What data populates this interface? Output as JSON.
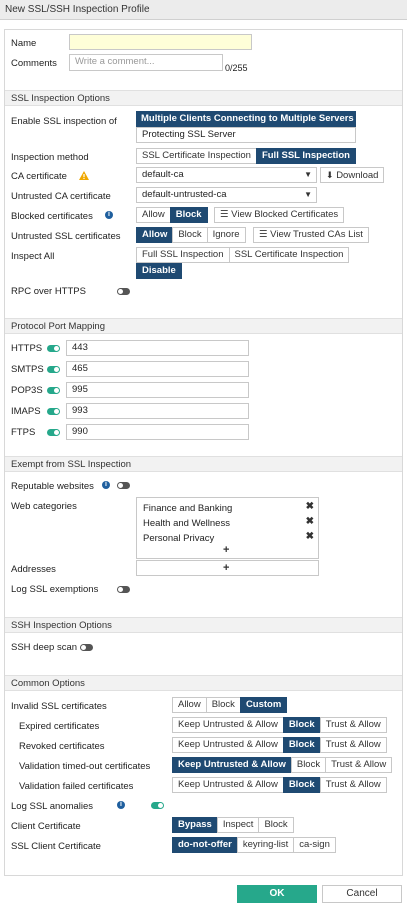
{
  "window": {
    "title": "New SSL/SSH Inspection Profile"
  },
  "general": {
    "name_label": "Name",
    "name_value": "",
    "comments_label": "Comments",
    "comments_placeholder": "Write a comment...",
    "comments_count": "0/255"
  },
  "ssl_options": {
    "header": "SSL Inspection Options",
    "enable_label": "Enable SSL inspection of",
    "enable_options": [
      "Multiple Clients Connecting to Multiple Servers",
      "Protecting SSL Server"
    ],
    "method_label": "Inspection method",
    "method_options": [
      "SSL Certificate Inspection",
      "Full SSL Inspection"
    ],
    "ca_label": "CA certificate",
    "ca_value": "default-ca",
    "download_label": "Download",
    "untrusted_ca_label": "Untrusted CA certificate",
    "untrusted_ca_value": "default-untrusted-ca",
    "blocked_label": "Blocked certificates",
    "blocked_options": [
      "Allow",
      "Block"
    ],
    "view_blocked_label": "View Blocked Certificates",
    "untrusted_ssl_label": "Untrusted SSL certificates",
    "untrusted_ssl_options": [
      "Allow",
      "Block",
      "Ignore"
    ],
    "view_trusted_label": "View Trusted CAs List",
    "inspect_all_label": "Inspect All",
    "inspect_all_options": [
      "Full SSL Inspection",
      "SSL Certificate Inspection",
      "Disable"
    ],
    "rpc_label": "RPC over HTTPS"
  },
  "port_mapping": {
    "header": "Protocol Port Mapping",
    "rows": [
      {
        "label": "HTTPS",
        "value": "443"
      },
      {
        "label": "SMTPS",
        "value": "465"
      },
      {
        "label": "POP3S",
        "value": "995"
      },
      {
        "label": "IMAPS",
        "value": "993"
      },
      {
        "label": "FTPS",
        "value": "990"
      }
    ]
  },
  "exempt": {
    "header": "Exempt from SSL Inspection",
    "reputable_label": "Reputable websites",
    "web_categories_label": "Web categories",
    "categories": [
      "Finance and Banking",
      "Health and Wellness",
      "Personal Privacy"
    ],
    "addresses_label": "Addresses",
    "log_label": "Log SSL exemptions"
  },
  "ssh": {
    "header": "SSH Inspection Options",
    "deep_scan_label": "SSH deep scan"
  },
  "common": {
    "header": "Common Options",
    "invalid_label": "Invalid SSL certificates",
    "invalid_options": [
      "Allow",
      "Block",
      "Custom"
    ],
    "cert_rows": [
      {
        "label": "Expired certificates",
        "options": [
          "Keep Untrusted & Allow",
          "Block",
          "Trust & Allow"
        ]
      },
      {
        "label": "Revoked certificates",
        "options": [
          "Keep Untrusted & Allow",
          "Block",
          "Trust & Allow"
        ]
      },
      {
        "label": "Validation timed-out certificates",
        "options": [
          "Keep Untrusted & Allow",
          "Block",
          "Trust & Allow"
        ]
      },
      {
        "label": "Validation failed certificates",
        "options": [
          "Keep Untrusted & Allow",
          "Block",
          "Trust & Allow"
        ]
      }
    ],
    "log_anomalies_label": "Log SSL anomalies",
    "client_cert_label": "Client Certificate",
    "client_cert_options": [
      "Bypass",
      "Inspect",
      "Block"
    ],
    "ssl_client_cert_label": "SSL Client Certificate",
    "ssl_client_cert_options": [
      "do-not-offer",
      "keyring-list",
      "ca-sign"
    ]
  },
  "footer": {
    "ok": "OK",
    "cancel": "Cancel"
  },
  "colors": {
    "selected": "#1f4a72",
    "toggle_on": "#26a88b",
    "ok_button": "#26a88b"
  },
  "icons": {
    "info": "info-circle-icon",
    "warning": "warning-triangle-icon",
    "download": "download-icon",
    "list": "list-icon",
    "remove": "remove-x-icon",
    "add": "plus-icon"
  }
}
